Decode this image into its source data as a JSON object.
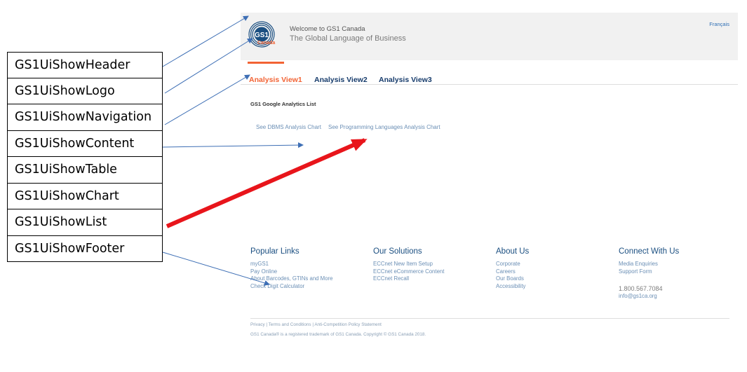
{
  "labels": [
    "GS1UiShowHeader",
    "GS1UiShowLogo",
    "GS1UiShowNavigation",
    "GS1UiShowContent",
    "GS1UiShowTable",
    "GS1UiShowChart",
    "GS1UiShowList",
    "GS1UiShowFooter"
  ],
  "site": {
    "logo_text": "GS1",
    "logo_sub": "Canada",
    "welcome": "Welcome to GS1 Canada",
    "tagline": "The Global Language of Business",
    "francais": "Français",
    "nav": [
      "Analysis View1",
      "Analysis View2",
      "Analysis View3"
    ],
    "content_title": "GS1 Google Analytics List",
    "content_links": [
      "See DBMS Analysis Chart",
      "See Programming Languages Analysis Chart"
    ],
    "footer": {
      "popular": {
        "heading": "Popular Links",
        "items": [
          "myGS1",
          "Pay Online",
          "About Barcodes, GTINs and More",
          "Check Digit Calculator"
        ]
      },
      "solutions": {
        "heading": "Our Solutions",
        "items": [
          "ECCnet New Item Setup",
          "ECCnet eCommerce Content",
          "ECCnet Recall"
        ]
      },
      "about": {
        "heading": "About Us",
        "items": [
          "Corporate",
          "Careers",
          "Our Boards",
          "Accessibility"
        ]
      },
      "connect": {
        "heading": "Connect With Us",
        "items": [
          "Media Enquiries",
          "Support Form"
        ],
        "phone": "1.800.567.7084",
        "email": "info@gs1ca.org"
      }
    },
    "legal": "Privacy  |  Terms and Conditions  |  Anti-Competition Policy Statement",
    "copyright": "GS1 Canada® is a registered trademark of GS1 Canada. Copyright © GS1 Canada 2018."
  },
  "colors": {
    "accent": "#f26334",
    "nav": "#163b6b",
    "link": "#6b8fb5",
    "arrow_blue": "#3e6fb5",
    "arrow_red": "#e8151b"
  }
}
